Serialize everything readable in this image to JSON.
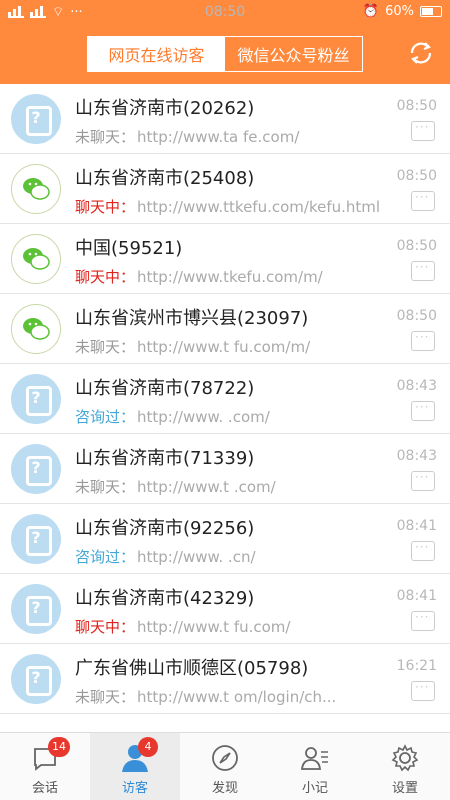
{
  "status_bar": {
    "time": "08:50",
    "battery": "60%"
  },
  "header": {
    "tabs": [
      {
        "label": "网页在线访客",
        "active": true
      },
      {
        "label": "微信公众号粉丝",
        "active": false
      }
    ],
    "accent_color": "#ff8a3d"
  },
  "visitors": [
    {
      "name": "山东省济南市(20262)",
      "status": "未聊天：",
      "url": "http://www.ta fe.com/",
      "time": "08:50",
      "avatar": "visitor-avatar"
    },
    {
      "name": "山东省济南市(25408)",
      "status": "聊天中：",
      "url": "http://www.ttkefu.com/kefu.html",
      "time": "08:50",
      "avatar": "wechat-avatar"
    },
    {
      "name": "中国(59521)",
      "status": "聊天中：",
      "url": "http://www.tkefu.com/m/",
      "time": "08:50",
      "avatar": "wechat-avatar"
    },
    {
      "name": "山东省滨州市博兴县(23097)",
      "status": "未聊天：",
      "url": "http://www.t fu.com/m/",
      "time": "08:50",
      "avatar": "wechat-avatar"
    },
    {
      "name": "山东省济南市(78722)",
      "status": "咨询过：",
      "url": "http://www. .com/",
      "time": "08:43",
      "avatar": "visitor-avatar"
    },
    {
      "name": "山东省济南市(71339)",
      "status": "未聊天：",
      "url": "http://www.t .com/",
      "time": "08:43",
      "avatar": "visitor-avatar"
    },
    {
      "name": "山东省济南市(92256)",
      "status": "咨询过：",
      "url": "http://www. .cn/",
      "time": "08:41",
      "avatar": "visitor-avatar"
    },
    {
      "name": "山东省济南市(42329)",
      "status": "聊天中：",
      "url": "http://www.t fu.com/",
      "time": "08:41",
      "avatar": "visitor-avatar"
    },
    {
      "name": "广东省佛山市顺德区(05798)",
      "status": "未聊天：",
      "url": "http://www.t om/login/ch...",
      "time": "16:21",
      "avatar": "visitor-avatar"
    }
  ],
  "tabbar": [
    {
      "label": "会话",
      "badge": "14",
      "icon": "chat-icon"
    },
    {
      "label": "访客",
      "badge": "4",
      "icon": "person-icon",
      "active": true
    },
    {
      "label": "发现",
      "badge": "",
      "icon": "compass-icon"
    },
    {
      "label": "小记",
      "badge": "",
      "icon": "contact-note-icon"
    },
    {
      "label": "设置",
      "badge": "",
      "icon": "gear-icon"
    }
  ]
}
